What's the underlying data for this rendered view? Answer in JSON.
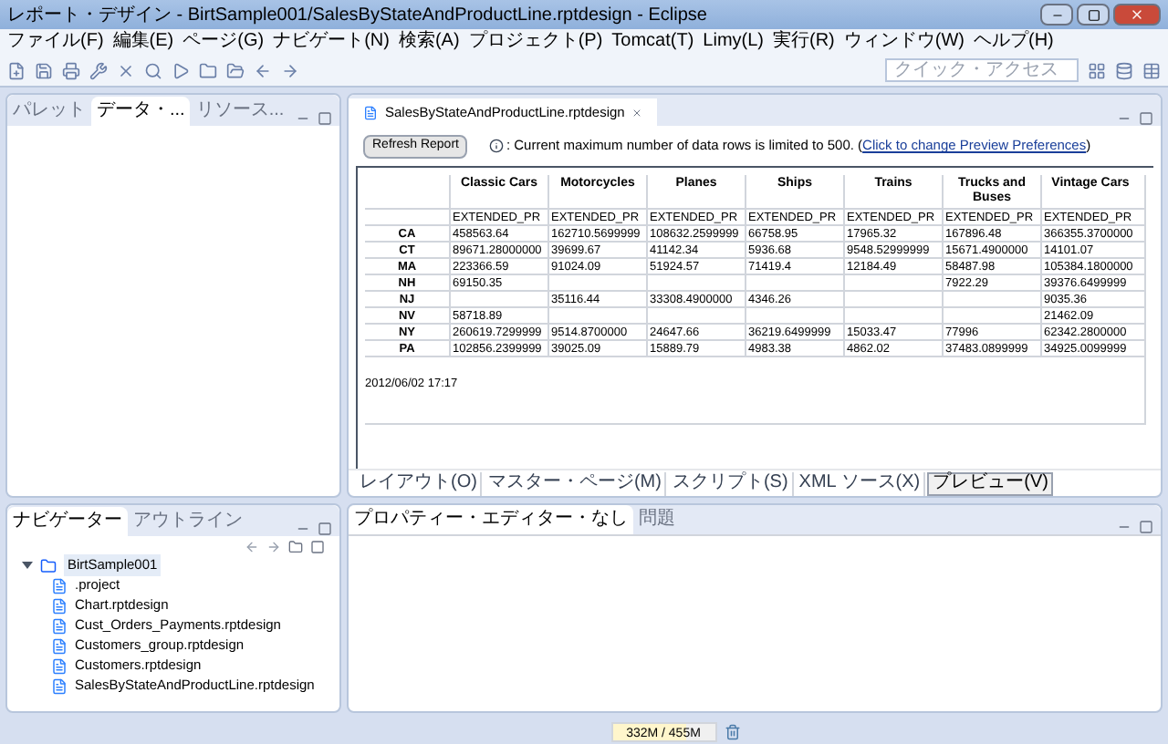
{
  "window": {
    "title": "レポート・デザイン - BirtSample001/SalesByStateAndProductLine.rptdesign - Eclipse"
  },
  "menu": [
    "ファイル(F)",
    "編集(E)",
    "ページ(G)",
    "ナビゲート(N)",
    "検索(A)",
    "プロジェクト(P)",
    "Tomcat(T)",
    "Limy(L)",
    "実行(R)",
    "ウィンドウ(W)",
    "ヘルプ(H)"
  ],
  "quick_access": {
    "placeholder": "クイック・アクセス"
  },
  "left_panel": {
    "tabs": [
      {
        "label": "パレット",
        "selected": false
      },
      {
        "label": "データ・...",
        "selected": true
      },
      {
        "label": "リソース...",
        "selected": false
      }
    ]
  },
  "editor": {
    "tab": "SalesByStateAndProductLine.rptdesign",
    "refresh_button": "Refresh Report",
    "message": ": Current maximum number of data rows is limited to 500. (",
    "message_link": "Click to change Preview Preferences",
    "message_end": ")",
    "report": {
      "columns": [
        "Classic Cars",
        "Motorcycles",
        "Planes",
        "Ships",
        "Trains",
        "Trucks and Buses",
        "Vintage Cars"
      ],
      "subheaders": [
        "EXTENDED_PR",
        "EXTENDED_PR",
        "EXTENDED_PR",
        "EXTENDED_PR",
        "EXTENDED_PR",
        "EXTENDED_PR",
        "EXTENDED_PR"
      ],
      "rows": [
        {
          "state": "CA",
          "cells": [
            "458563.64",
            "162710.5699999",
            "108632.2599999",
            "66758.95",
            "17965.32",
            "167896.48",
            "366355.3700000"
          ]
        },
        {
          "state": "CT",
          "cells": [
            "89671.28000000",
            "39699.67",
            "41142.34",
            "5936.68",
            "9548.52999999",
            "15671.4900000",
            "14101.07"
          ]
        },
        {
          "state": "MA",
          "cells": [
            "223366.59",
            "91024.09",
            "51924.57",
            "71419.4",
            "12184.49",
            "58487.98",
            "105384.1800000"
          ]
        },
        {
          "state": "NH",
          "cells": [
            "69150.35",
            null,
            null,
            null,
            null,
            "7922.29",
            "39376.6499999"
          ]
        },
        {
          "state": "NJ",
          "cells": [
            null,
            "35116.44",
            "33308.4900000",
            "4346.26",
            null,
            null,
            "9035.36"
          ]
        },
        {
          "state": "NV",
          "cells": [
            "58718.89",
            null,
            null,
            null,
            null,
            null,
            "21462.09"
          ]
        },
        {
          "state": "NY",
          "cells": [
            "260619.7299999",
            "9514.8700000",
            "24647.66",
            "36219.6499999",
            "15033.47",
            "77996",
            "62342.2800000"
          ]
        },
        {
          "state": "PA",
          "cells": [
            "102856.2399999",
            "39025.09",
            "15889.79",
            "4983.38",
            "4862.02",
            "37483.0899999",
            "34925.0099999"
          ]
        }
      ],
      "timestamp": "2012/06/02 17:17"
    },
    "bottom_tabs": [
      {
        "label": "レイアウト(O)",
        "selected": false
      },
      {
        "label": "マスター・ページ(M)",
        "selected": false
      },
      {
        "label": "スクリプト(S)",
        "selected": false
      },
      {
        "label": "XML ソース(X)",
        "selected": false
      },
      {
        "label": "プレビュー(V)",
        "selected": true
      }
    ]
  },
  "navigator": {
    "tabs": [
      {
        "label": "ナビゲーター",
        "selected": true
      },
      {
        "label": "アウトライン",
        "selected": false
      }
    ],
    "tree": [
      {
        "label": "BirtSample001",
        "expanded": true,
        "selected": true,
        "children": [
          {
            "label": ".project",
            "selected": false
          },
          {
            "label": "Chart.rptdesign",
            "selected": false
          },
          {
            "label": "Cust_Orders_Payments.rptdesign",
            "selected": false
          },
          {
            "label": "Customers_group.rptdesign",
            "selected": false
          },
          {
            "label": "Customers.rptdesign",
            "selected": false
          },
          {
            "label": "SalesByStateAndProductLine.rptdesign",
            "selected": false
          }
        ]
      }
    ]
  },
  "properties": {
    "tabs": [
      {
        "label": "プロパティー・エディター・なし",
        "selected": true
      },
      {
        "label": "問題",
        "selected": false
      }
    ]
  },
  "status_bar": {
    "memory": "332M / 455M",
    "level": 0.73
  }
}
